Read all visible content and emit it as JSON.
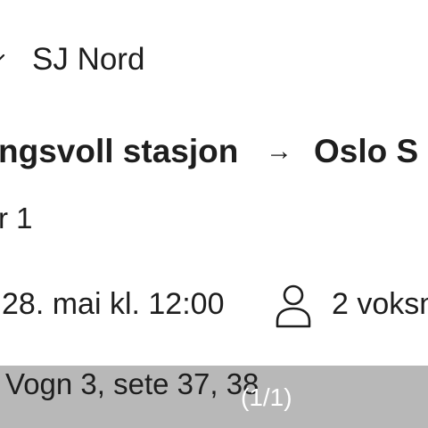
{
  "operator": {
    "name": "SJ Nord",
    "icon": "chevron-down-icon"
  },
  "route": {
    "from": "ngsvoll stasjon",
    "arrow": "→",
    "to": "Oslo S"
  },
  "class_label": "r 1",
  "departure": "28. mai kl. 12:00",
  "passengers": {
    "icon": "person-icon",
    "text": "2 voksn"
  },
  "seat": "Vogn 3, sete 37, 38",
  "image_counter": "(1/1)"
}
